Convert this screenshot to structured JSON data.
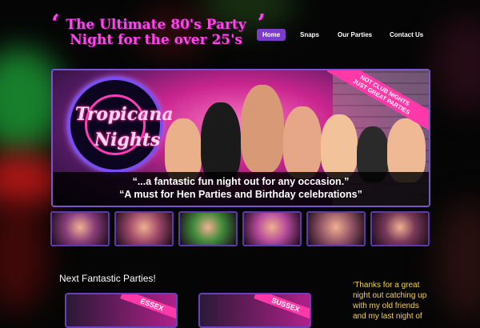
{
  "site": {
    "title_line1": "The Ultimate 80's Party",
    "title_line2": "Night for the over 25's",
    "quote_open": "‘",
    "quote_close": "’"
  },
  "nav": {
    "items": [
      {
        "label": "Home",
        "active": true
      },
      {
        "label": "Snaps",
        "active": false
      },
      {
        "label": "Our Parties",
        "active": false
      },
      {
        "label": "Contact Us",
        "active": false
      }
    ]
  },
  "hero": {
    "logo_word1": "Tropicana",
    "logo_word2": "Nights",
    "sash_line1": "NOT CLUB NIGHTS",
    "sash_line2": "JUST GREAT PARTIES",
    "caption_line1": "“...a fantastic fun night out for any occasion.”",
    "caption_line2": "“A must for Hen Parties and Birthday celebrations”"
  },
  "thumbnails": [
    {
      "icon": "party-photo-thumbnail",
      "color": "#8a3f7a"
    },
    {
      "icon": "party-photo-thumbnail",
      "color": "#a04a6a"
    },
    {
      "icon": "party-photo-thumbnail",
      "color": "#3f8a3a"
    },
    {
      "icon": "party-photo-thumbnail",
      "color": "#b54a9a"
    },
    {
      "icon": "party-photo-thumbnail",
      "color": "#9a5a6a"
    },
    {
      "icon": "party-photo-thumbnail",
      "color": "#7a3a5a"
    }
  ],
  "next_parties": {
    "title": "Next Fantastic Parties!",
    "events": [
      {
        "label": "ESSEX"
      },
      {
        "label": "SUSSEX"
      }
    ]
  },
  "testimonial": {
    "text": "‘Thanks for a great night out catching up with my old friends and my last night of"
  },
  "colors": {
    "accent_pink": "#ff46ec",
    "nav_active": "#7c3cc8",
    "frame_purple": "#7a55c8",
    "quote_yellow": "#f7d24a"
  }
}
